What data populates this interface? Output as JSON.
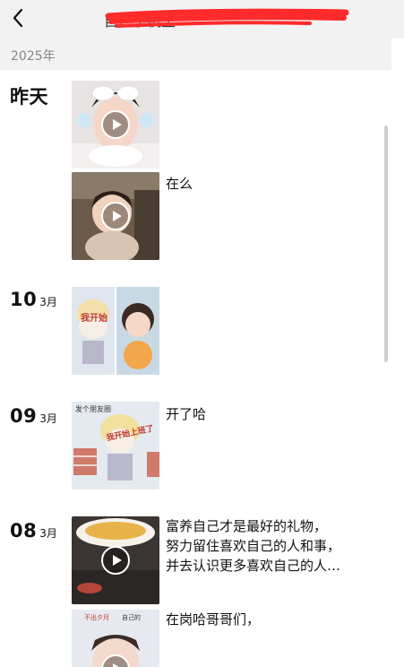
{
  "header": {
    "title": "自己手机里",
    "back_icon": "chevron-left-icon"
  },
  "year_label": "2025年",
  "entries": {
    "yesterday": {
      "label": "昨天",
      "caption": "在么"
    },
    "d10": {
      "day": "10",
      "month": "3月"
    },
    "d09": {
      "day": "09",
      "month": "3月",
      "caption": "开了哈"
    },
    "d08": {
      "day": "08",
      "month": "3月",
      "caption1": "富养自己才是最好的礼物，\n努力留住喜欢自己的人和事，\n并去认识更多喜欢自己的人…",
      "caption2": "在岗哈哥哥们，"
    }
  },
  "stickers": {
    "s1": "我开始",
    "s2": "发个朋友圈",
    "s3": "我开始上班了",
    "s4": "不出夕月",
    "s5": "自己的"
  },
  "colors": {
    "accent_red": "#ff2b2b",
    "header_bg": "#f2f2f2"
  }
}
